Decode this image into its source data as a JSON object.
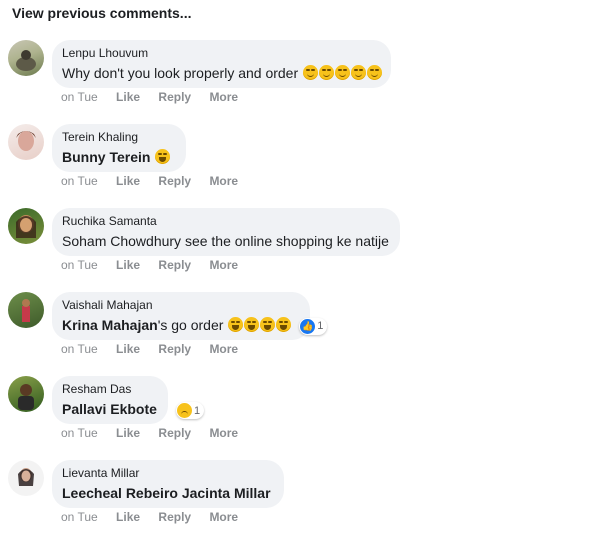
{
  "header": {
    "view_previous": "View previous comments..."
  },
  "comments": [
    {
      "author": "Lenpu Lhouvum",
      "text": "Why don't you look properly and order",
      "mention": "",
      "time": "on Tue",
      "like": "Like",
      "reply": "Reply",
      "more": "More",
      "avatar_colors": [
        "#8a8f6a",
        "#c8c6b4"
      ]
    },
    {
      "author": "Terein Khaling",
      "text": "",
      "mention": "Bunny Terein",
      "time": "on Tue",
      "like": "Like",
      "reply": "Reply",
      "more": "More",
      "avatar_colors": [
        "#e8cfc8",
        "#f4ecea"
      ]
    },
    {
      "author": "Ruchika Samanta",
      "text": "Soham Chowdhury see the online shopping ke natije",
      "mention": "",
      "time": "on Tue",
      "like": "Like",
      "reply": "Reply",
      "more": "More",
      "avatar_colors": [
        "#9a6b3a",
        "#3b6a2a"
      ]
    },
    {
      "author": "Vaishali Mahajan",
      "text": "'s go order",
      "mention": "Krina Mahajan",
      "time": "on Tue",
      "like": "Like",
      "reply": "Reply",
      "more": "More",
      "reaction_count": "1",
      "avatar_colors": [
        "#5a7f3a",
        "#c63a4a"
      ]
    },
    {
      "author": "Resham Das",
      "text": "",
      "mention": "Pallavi Ekbote",
      "time": "on Tue",
      "like": "Like",
      "reply": "Reply",
      "more": "More",
      "reaction_count": "1",
      "avatar_colors": [
        "#2f5a1e",
        "#8aa04a"
      ]
    },
    {
      "author": "Lievanta Millar",
      "text": "",
      "mention": "Leecheal Rebeiro Jacinta Millar",
      "time": "on Tue",
      "like": "Like",
      "reply": "Reply",
      "more": "More",
      "avatar_colors": [
        "#f3f3f3",
        "#c9a08a"
      ]
    }
  ]
}
